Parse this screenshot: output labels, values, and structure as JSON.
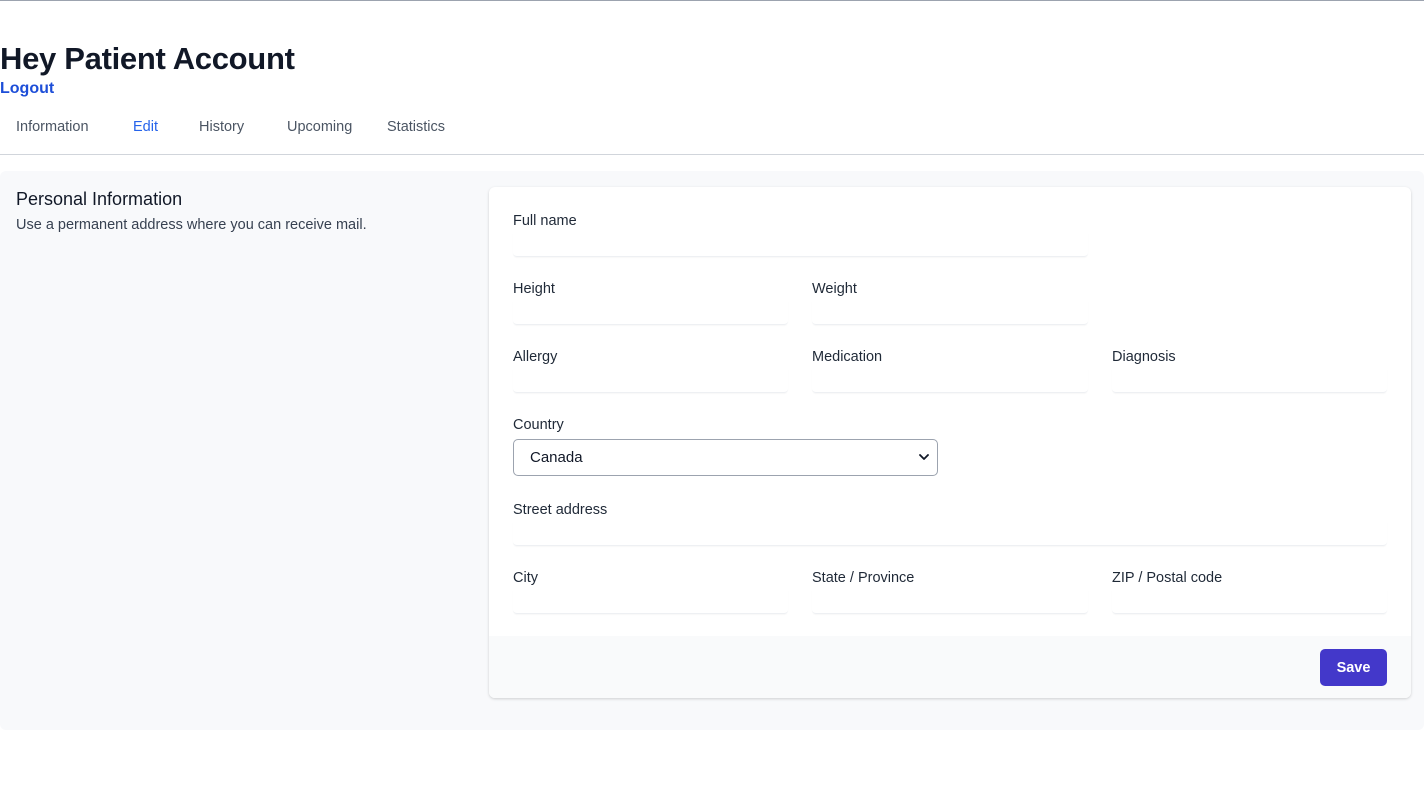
{
  "header": {
    "title": "Hey Patient Account",
    "logout_label": "Logout"
  },
  "tabs": [
    {
      "label": "Information",
      "active": false
    },
    {
      "label": "Edit",
      "active": true
    },
    {
      "label": "History",
      "active": false
    },
    {
      "label": "Upcoming",
      "active": false
    },
    {
      "label": "Statistics",
      "active": false
    }
  ],
  "section": {
    "title": "Personal Information",
    "description": "Use a permanent address where you can receive mail."
  },
  "form": {
    "full_name": {
      "label": "Full name",
      "value": ""
    },
    "height": {
      "label": "Height",
      "value": ""
    },
    "weight": {
      "label": "Weight",
      "value": ""
    },
    "allergy": {
      "label": "Allergy",
      "value": ""
    },
    "medication": {
      "label": "Medication",
      "value": ""
    },
    "diagnosis": {
      "label": "Diagnosis",
      "value": ""
    },
    "country": {
      "label": "Country",
      "selected": "Canada"
    },
    "street_address": {
      "label": "Street address",
      "value": ""
    },
    "city": {
      "label": "City",
      "value": ""
    },
    "state": {
      "label": "State / Province",
      "value": ""
    },
    "zip": {
      "label": "ZIP / Postal code",
      "value": ""
    },
    "save_label": "Save"
  },
  "colors": {
    "accent": "#4338ca",
    "link": "#1d4ed8",
    "active_tab": "#2563eb",
    "panel_bg": "#f8f9fb"
  }
}
